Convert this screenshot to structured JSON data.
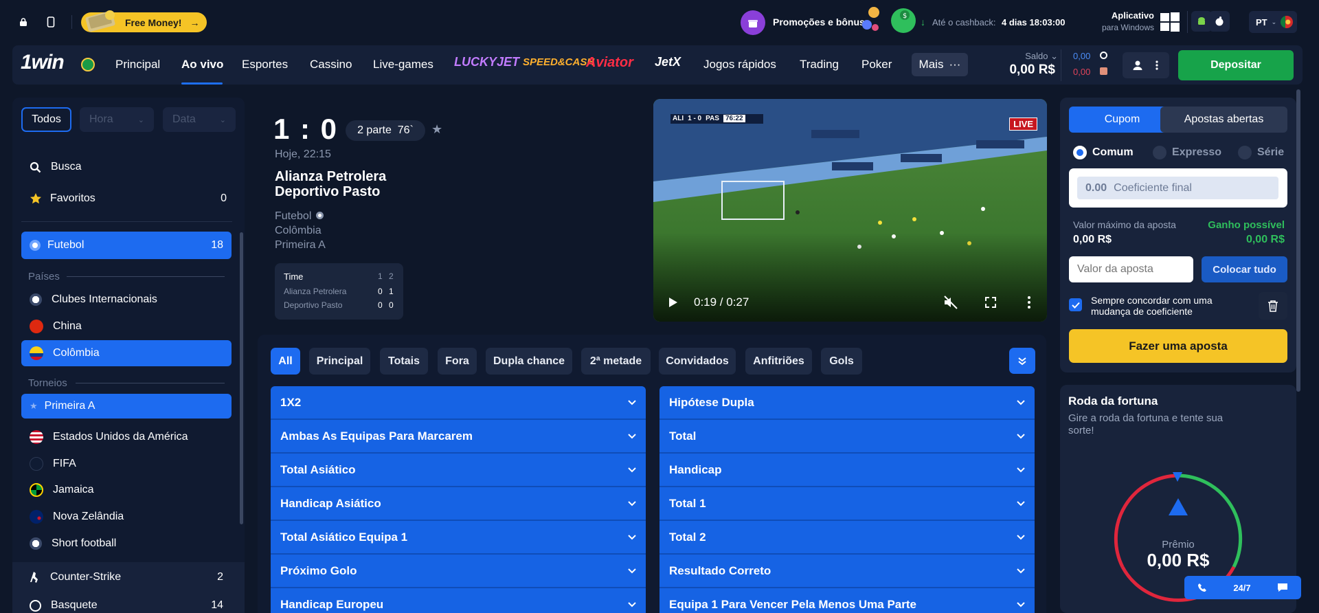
{
  "topbar": {
    "free_money": "Free Money!",
    "promo_label": "Promoções e bônus",
    "cashback_prefix": "Até o cashback:",
    "cashback_time": "4 dias 18:03:00",
    "app_title": "Aplicativo",
    "app_sub": "para Windows",
    "lang": "PT"
  },
  "nav": {
    "logo": "1win",
    "items": [
      "Principal",
      "Ao vivo",
      "Esportes",
      "Cassino",
      "Live-games"
    ],
    "games": [
      "LUCKYJET",
      "SPEED&CASH",
      "Aviator",
      "JetX"
    ],
    "items2": [
      "Jogos rápidos",
      "Trading",
      "Poker"
    ],
    "mais": "Mais",
    "saldo_label": "Saldo",
    "saldo_value": "0,00 R$",
    "bonus1": "0,00",
    "bonus2": "0,00",
    "deposit": "Depositar"
  },
  "sidebar": {
    "filters": {
      "all": "Todos",
      "hour": "Hora",
      "date": "Data"
    },
    "search": "Busca",
    "favorites": "Favoritos",
    "favorites_count": "0",
    "sport": "Futebol",
    "sport_count": "18",
    "countries_label": "Países",
    "countries": [
      "Clubes Internacionais",
      "China",
      "Colômbia"
    ],
    "tournaments_label": "Torneios",
    "tournament": "Primeira A",
    "others": [
      "Estados Unidos da América",
      "FIFA",
      "Jamaica",
      "Nova Zelândia",
      "Short football"
    ],
    "sports2": [
      {
        "name": "Counter-Strike",
        "count": "2"
      },
      {
        "name": "Basquete",
        "count": "14"
      }
    ]
  },
  "match": {
    "score": "1 : 0",
    "part": "2 parte",
    "minute": "76`",
    "time": "Hoje, 22:15",
    "team1": "Alianza Petrolera",
    "team2": "Deportivo Pasto",
    "sport": "Futebol",
    "country": "Colômbia",
    "league": "Primeira A",
    "table": {
      "header": "Time",
      "cols": [
        "1",
        "2"
      ],
      "rows": [
        {
          "team": "Alianza Petrolera",
          "v1": "0",
          "v2": "1"
        },
        {
          "team": "Deportivo Pasto",
          "v1": "0",
          "v2": "0"
        }
      ]
    }
  },
  "video": {
    "live": "LIVE",
    "time": "0:19 / 0:27",
    "scoreboard": [
      "ALI",
      "1 - 0",
      "PAS",
      "76:22"
    ],
    "progress": 0.7
  },
  "market_tabs": [
    "All",
    "Principal",
    "Totais",
    "Fora",
    "Dupla chance",
    "2ª metade",
    "Convidados",
    "Anfitriões",
    "Gols"
  ],
  "markets_left": [
    "1X2",
    "Ambas As Equipas Para Marcarem",
    "Total Asiático",
    "Handicap Asiático",
    "Total Asiático Equipa 1",
    "Próximo Golo",
    "Handicap Europeu"
  ],
  "markets_right": [
    "Hipótese Dupla",
    "Total",
    "Handicap",
    "Total 1",
    "Total 2",
    "Resultado Correto",
    "Equipa 1 Para Vencer Pela Menos Uma Parte"
  ],
  "betslip": {
    "tab_coupon": "Cupom",
    "tab_open": "Apostas abertas",
    "types": [
      "Comum",
      "Expresso",
      "Série"
    ],
    "coef_value": "0.00",
    "coef_label": "Coeficiente final",
    "max_label": "Valor máximo da aposta",
    "max_value": "0,00 R$",
    "win_label": "Ganho possível",
    "win_value": "0,00 R$",
    "stake_placeholder": "Valor da aposta",
    "place_all": "Colocar tudo",
    "agree": "Sempre concordar com uma mudança de coeficiente",
    "bet": "Fazer uma aposta"
  },
  "fortune": {
    "title": "Roda da fortuna",
    "desc": "Gire a roda da fortuna e tente sua sorte!",
    "prize_label": "Prêmio",
    "prize_value": "0,00 R$"
  },
  "support": {
    "label": "24/7"
  }
}
